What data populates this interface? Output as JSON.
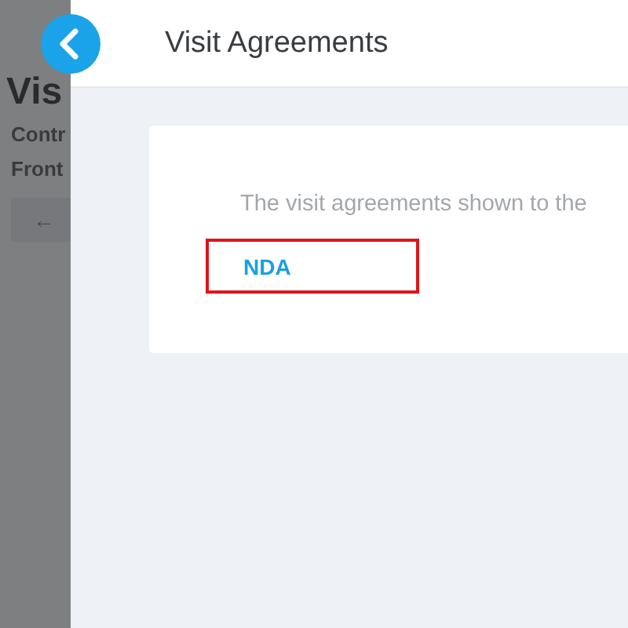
{
  "background_page": {
    "title": "Vis",
    "lines": [
      "Contr",
      "Front"
    ],
    "back_button": "←"
  },
  "panel": {
    "title": "Visit Agreements",
    "card": {
      "description": "The visit agreements shown to the",
      "agreements": [
        {
          "label": "NDA",
          "highlighted": true
        }
      ]
    }
  }
}
